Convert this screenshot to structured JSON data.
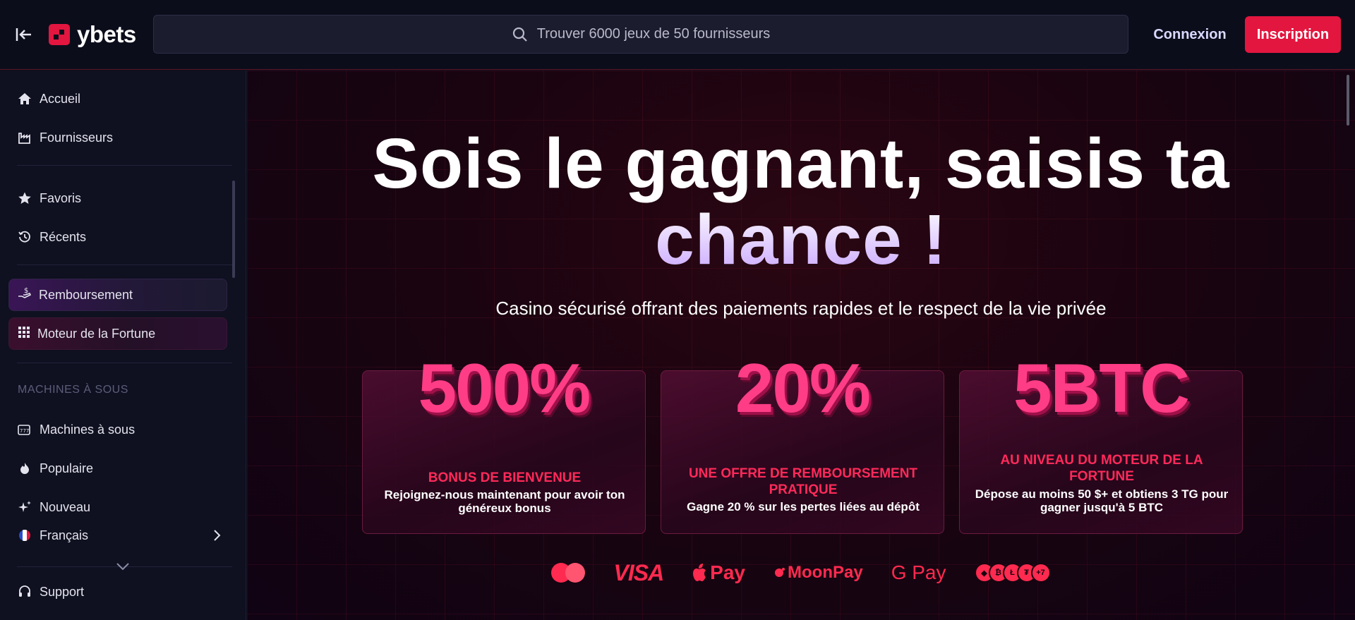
{
  "header": {
    "logo_text": "ybets",
    "search_placeholder": "Trouver 6000 jeux de 50 fournisseurs",
    "login_label": "Connexion",
    "signup_label": "Inscription"
  },
  "sidebar": {
    "items_top": [
      {
        "label": "Accueil",
        "icon": "home-icon"
      },
      {
        "label": "Fournisseurs",
        "icon": "factory-icon"
      }
    ],
    "items_mid": [
      {
        "label": "Favoris",
        "icon": "star-icon"
      },
      {
        "label": "Récents",
        "icon": "history-icon"
      }
    ],
    "promos": [
      {
        "label": "Remboursement",
        "icon": "cashback-icon"
      },
      {
        "label": "Moteur de la Fortune",
        "icon": "grid-icon"
      }
    ],
    "section_label": "MACHINES À SOUS",
    "items_slots": [
      {
        "label": "Machines à sous",
        "icon": "slot-machine-icon"
      },
      {
        "label": "Populaire",
        "icon": "flame-icon"
      },
      {
        "label": "Nouveau",
        "icon": "sparkle-icon"
      }
    ],
    "language": "Français",
    "support": "Support"
  },
  "hero": {
    "title_line1": "Sois le gagnant, saisis ta",
    "title_line2": "chance !",
    "subtitle": "Casino sécurisé offrant des paiements rapides et le respect de la vie privée"
  },
  "cards": [
    {
      "big": "500%",
      "title": "BONUS DE BIENVENUE",
      "desc": "Rejoignez-nous maintenant pour avoir ton généreux bonus"
    },
    {
      "big": "20%",
      "title": "UNE OFFRE DE REMBOURSEMENT PRATIQUE",
      "desc": "Gagne 20 % sur les pertes liées au dépôt"
    },
    {
      "big": "5BTC",
      "title": "AU NIVEAU DU MOTEUR DE LA FORTUNE",
      "desc": "Dépose au moins 50 $+ et obtiens 3 TG pour gagner jusqu'à 5 BTC"
    }
  ],
  "payments": {
    "visa": "VISA",
    "apple_pay": "Pay",
    "moonpay": "MoonPay",
    "google_pay": "G Pay",
    "crypto_more": "+7"
  },
  "colors": {
    "accent": "#e3163f",
    "pink": "#ff3d86"
  }
}
